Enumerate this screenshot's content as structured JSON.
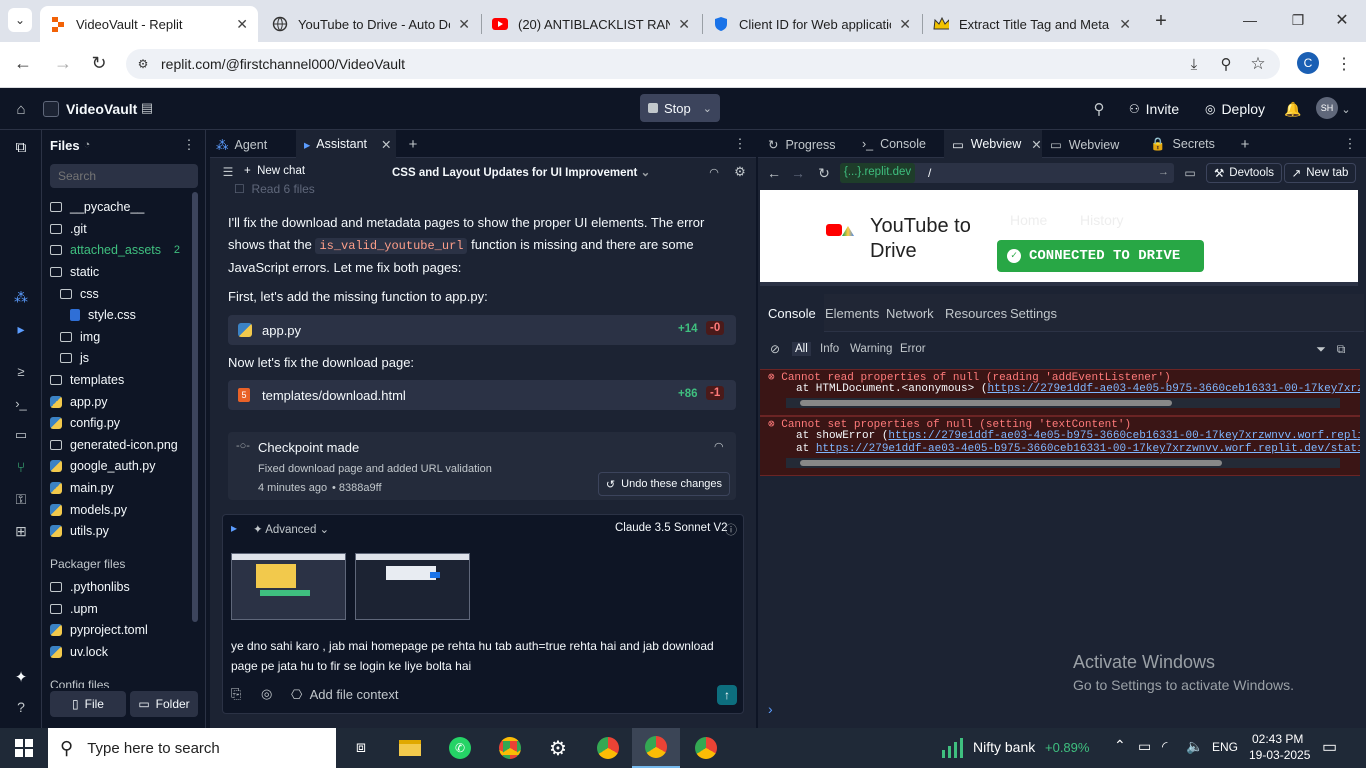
{
  "browser": {
    "tabs": [
      {
        "title": "VideoVault - Replit",
        "active": true
      },
      {
        "title": "YouTube to Drive - Auto Dow"
      },
      {
        "title": "(20) ANTIBLACKLIST RANK W"
      },
      {
        "title": "Client ID for Web application"
      },
      {
        "title": "Extract Title Tag and Meta De"
      }
    ],
    "url": "replit.com/@firstchannel000/VideoVault",
    "profile_initial": "C"
  },
  "replit": {
    "project": "VideoVault",
    "stop_label": "Stop",
    "invite_label": "Invite",
    "deploy_label": "Deploy",
    "user_initials": "SH",
    "files": {
      "title": "Files",
      "search_placeholder": "Search",
      "items": [
        "__pycache__",
        ".git",
        "attached_assets",
        "static",
        "css",
        "style.css",
        "img",
        "js",
        "templates",
        "app.py",
        "config.py",
        "generated-icon.png",
        "google_auth.py",
        "main.py",
        "models.py",
        "utils.py"
      ],
      "attached_badge": "2",
      "packager_title": "Packager files",
      "packager_items": [
        ".pythonlibs",
        ".upm",
        "pyproject.toml",
        "uv.lock"
      ],
      "config_title": "Config files",
      "new_file_label": "File",
      "new_folder_label": "Folder"
    },
    "assistant": {
      "tab_agent": "Agent",
      "tab_assistant": "Assistant",
      "new_chat": "New chat",
      "chat_title": "CSS and Layout Updates for UI Improvement",
      "read_files": "Read 6 files",
      "msg1_a": "I'll fix the download and metadata pages to show the proper UI elements. The error shows that the",
      "msg1_code": "is_valid_youtube_url",
      "msg1_b": "function is missing and there are some JavaScript errors. Let me fix both pages:",
      "msg2": "First, let's add the missing function to app.py:",
      "file1": {
        "name": "app.py",
        "add": "+14",
        "del": "-0"
      },
      "msg3": "Now let's fix the download page:",
      "file2": {
        "name": "templates/download.html",
        "add": "+86",
        "del": "-1"
      },
      "checkpoint_title": "Checkpoint made",
      "checkpoint_desc": "Fixed download page and added URL validation",
      "checkpoint_time": "4 minutes ago",
      "checkpoint_hash": "8388a9ff",
      "undo_label": "Undo these changes",
      "advanced_label": "Advanced",
      "model": "Claude 3.5 Sonnet V2",
      "input_text": "ye dno sahi karo , jab mai homepage pe rehta hu tab auth=true rehta hai and jab download page pe jata hu to fir se login ke liye bolta hai",
      "add_context": "Add file context"
    },
    "right": {
      "tabs": [
        "Progress",
        "Console",
        "Webview",
        "Webview",
        "Secrets"
      ],
      "domain": "{...}.replit.dev",
      "path": "/",
      "devtools": "Devtools",
      "new_tab": "New tab",
      "site_title_1": "YouTube to",
      "site_title_2": "Drive",
      "site_nav_home": "Home",
      "site_nav_history": "History",
      "connected": "CONNECTED TO DRIVE",
      "dev_tabs": [
        "Console",
        "Elements",
        "Network",
        "Resources",
        "Settings"
      ],
      "filters": [
        "All",
        "Info",
        "Warning",
        "Error"
      ],
      "errors": [
        {
          "msg": "Cannot read properties of null (reading 'addEventListener')",
          "line1_pre": "at HTMLDocument.<anonymous> (",
          "line1_link": "https://279e1ddf-ae03-4e05-b975-3660ceb16331-00-17key7xrzwnvv.wor"
        },
        {
          "msg": "Cannot set properties of null (setting 'textContent')",
          "line1_pre": "at showError (",
          "line1_link": "https://279e1ddf-ae03-4e05-b975-3660ceb16331-00-17key7xrzwnvv.worf.replit.dev/st",
          "line2_pre": "at ",
          "line2_link": "https://279e1ddf-ae03-4e05-b975-3660ceb16331-00-17key7xrzwnvv.worf.replit.dev/static/js/sc"
        }
      ],
      "activate_title": "Activate Windows",
      "activate_sub": "Go to Settings to activate Windows."
    }
  },
  "taskbar": {
    "search_placeholder": "Type here to search",
    "stock_name": "Nifty bank",
    "stock_change": "+0.89%",
    "lang": "ENG",
    "time": "02:43 PM",
    "date": "19-03-2025"
  }
}
